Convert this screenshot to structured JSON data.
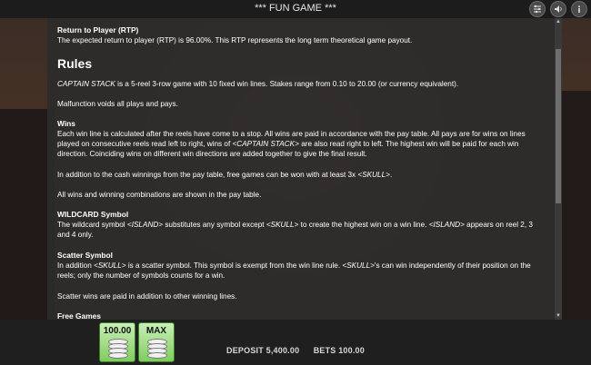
{
  "window": {
    "title": "*** FUN GAME ***"
  },
  "top_icons": [
    {
      "name": "settings-sliders-icon",
      "glyph": "☰"
    },
    {
      "name": "sound-icon",
      "glyph": "◀"
    },
    {
      "name": "info-icon",
      "glyph": "i"
    }
  ],
  "rules": {
    "rtp_heading": "Return to Player (RTP)",
    "rtp_text": "The expected return to player (RTP) is 96.00%. This RTP represents the long term theoretical game payout.",
    "rules_heading": "Rules",
    "intro_game_name": "CAPTAIN STACK",
    "intro_text": " is a 5-reel 3-row game with 10 fixed win lines. Stakes range from 0.10 to 20.00 (or currency equivalent).",
    "malfunction": "Malfunction voids all plays and pays.",
    "wins_heading": "Wins",
    "wins_text_1": "Each win line is calculated after the reels have come to a stop. All wins are paid in accordance with the pay table. All pays are for wins on lines played on consecutive reels read left to right, wins of ",
    "wins_symbol": "<CAPTAIN STACK>",
    "wins_text_2": " are also read right to left. The highest win will be paid for each win direction. Coinciding wins on different win directions are added together to give the final result.",
    "cash_text": "In addition to the cash winnings from the pay table, free games can be won with at least 3x ",
    "cash_symbol": "<SKULL>",
    "cash_end": ".",
    "all_wins": "All wins and winning combinations are shown in the pay table.",
    "wild_heading": "WILDCARD Symbol",
    "wild_text_1": "The wildcard symbol ",
    "wild_symbol_1": "<ISLAND>",
    "wild_text_2": " substitutes any symbol except ",
    "wild_symbol_2": "<SKULL>",
    "wild_text_3": " to create the highest win on a win line. ",
    "wild_symbol_3": "<ISLAND>",
    "wild_text_4": " appears on reel 2, 3 and 4 only.",
    "scatter_heading": "Scatter Symbol",
    "scatter_text_1": "In addition ",
    "scatter_symbol_1": "<SKULL>",
    "scatter_text_2": " is a scatter symbol. This symbol is exempt from the win line rule. ",
    "scatter_symbol_2": "<SKULL>",
    "scatter_text_3": "'s can win independently of their position on the reels; only the number of symbols counts for a win.",
    "scatter_paid": "Scatter wins are paid in addition to other winning lines.",
    "free_games_heading": "Free Games"
  },
  "bottom": {
    "bet_button_label": "100.00",
    "max_button_label": "MAX",
    "deposit_label": "DEPOSIT",
    "deposit_value": "5,400.00",
    "bets_label": "BETS",
    "bets_value": "100.00"
  },
  "colors": {
    "panel_bg": "#2c2c2c",
    "button_green": "#7fcc5d",
    "topbar_bg": "#1c1c1c"
  }
}
